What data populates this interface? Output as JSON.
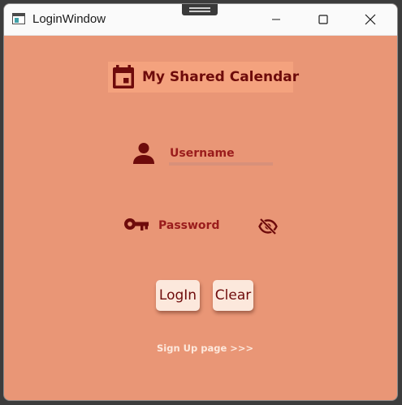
{
  "window": {
    "title": "LoginWindow"
  },
  "header": {
    "title": "My Shared Calendar",
    "icon": "calendar-icon"
  },
  "form": {
    "username_placeholder": "Username",
    "username_value": "",
    "password_placeholder": "Password",
    "password_value": "",
    "user_icon": "person-icon",
    "key_icon": "key-icon",
    "visibility_icon": "eye-off-icon"
  },
  "buttons": {
    "login_label": "LogIn",
    "clear_label": "Clear"
  },
  "links": {
    "signup_label": "Sign Up page >>>"
  },
  "colors": {
    "window_background": "#e99676",
    "header_highlight": "#f4a27e",
    "accent_dark_red": "#6e0b0b",
    "field_text": "#9a1c1c",
    "button_background": "#fce8dc",
    "link_text": "#fde8dc"
  }
}
